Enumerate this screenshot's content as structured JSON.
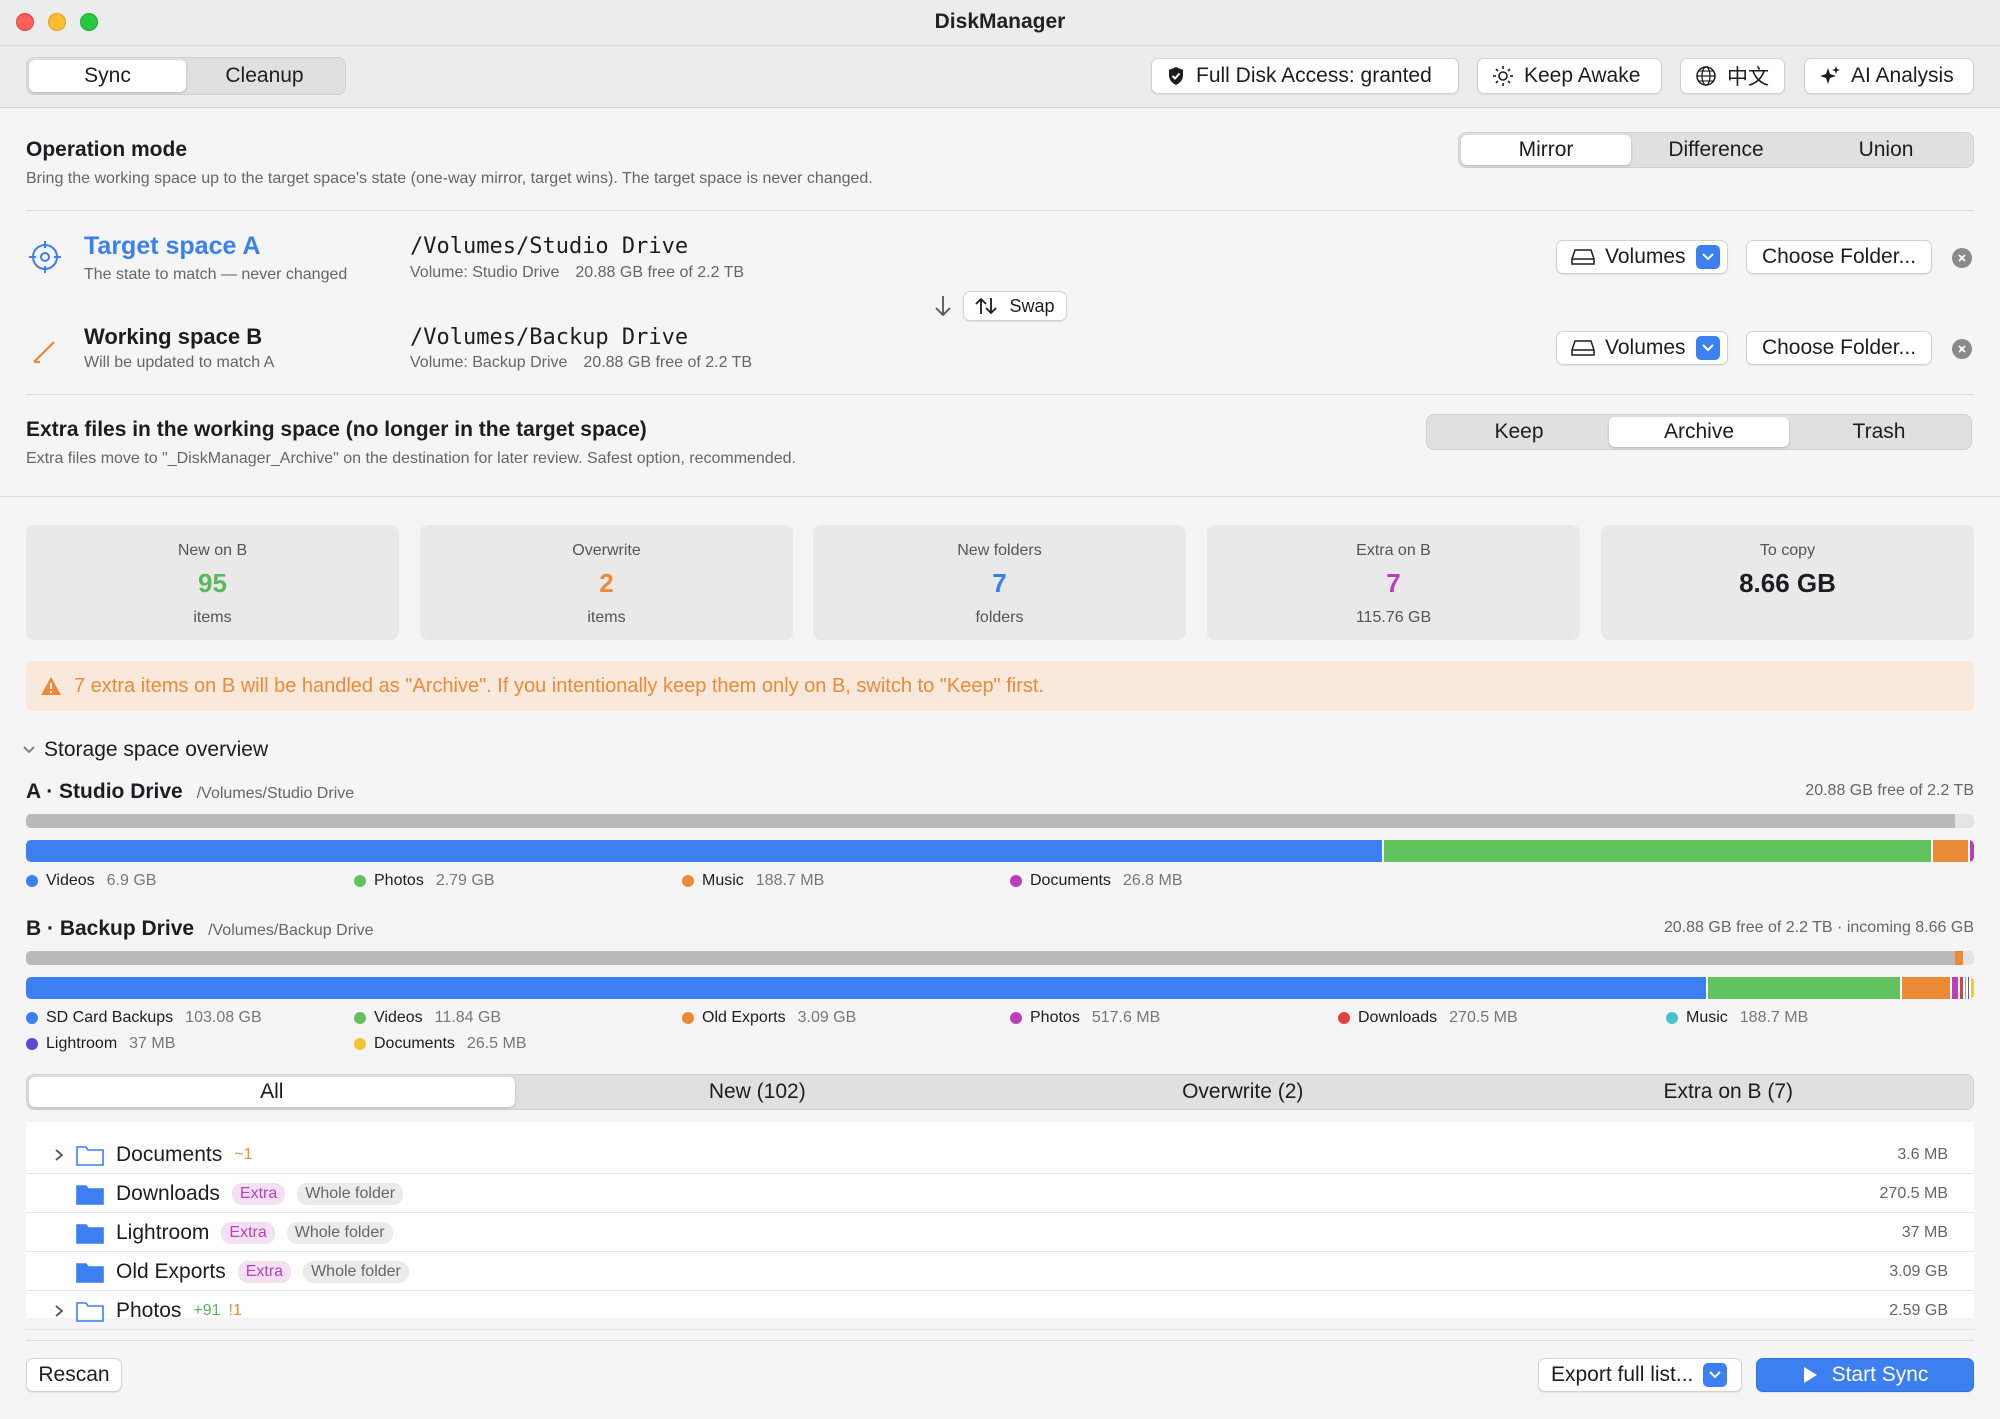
{
  "window": {
    "title": "DiskManager"
  },
  "toolbar": {
    "mode_tabs": [
      "Sync",
      "Cleanup"
    ],
    "full_disk_access": "Full Disk Access: granted",
    "keep_awake": "Keep Awake",
    "language": "中文",
    "ai_analysis": "AI Analysis"
  },
  "operation": {
    "title": "Operation mode",
    "description": "Bring the working space up to the target space's state (one-way mirror, target wins). The target space is never changed.",
    "modes": [
      "Mirror",
      "Difference",
      "Union"
    ],
    "selected": "Mirror"
  },
  "spaces": {
    "target": {
      "title": "Target space A",
      "subtitle": "The state to match — never changed",
      "path": "/Volumes/Studio Drive",
      "volume": "Volume: Studio Drive",
      "free": "20.88 GB free of 2.2 TB"
    },
    "working": {
      "title": "Working space B",
      "subtitle": "Will be updated to match A",
      "path": "/Volumes/Backup Drive",
      "volume": "Volume: Backup Drive",
      "free": "20.88 GB free of 2.2 TB"
    },
    "swap_label": "Swap",
    "volumes_label": "Volumes",
    "choose_folder_label": "Choose Folder..."
  },
  "extra": {
    "title": "Extra files in the working space (no longer in the target space)",
    "description": "Extra files move to \"_DiskManager_Archive\" on the destination for later review. Safest option, recommended.",
    "options": [
      "Keep",
      "Archive",
      "Trash"
    ],
    "selected": "Archive"
  },
  "stats": [
    {
      "label": "New on B",
      "value": "95",
      "unit": "items",
      "color": "#5cb85c"
    },
    {
      "label": "Overwrite",
      "value": "2",
      "unit": "items",
      "color": "#ec8a36"
    },
    {
      "label": "New folders",
      "value": "7",
      "unit": "folders",
      "color": "#3b7ff0"
    },
    {
      "label": "Extra on B",
      "value": "7",
      "unit": "115.76 GB",
      "color": "#b93fbd"
    },
    {
      "label": "To copy",
      "value": "8.66 GB",
      "unit": "",
      "color": "#1d1d1f"
    }
  ],
  "warning": "7 extra items on B will be handled as \"Archive\". If you intentionally keep them only on B, switch to \"Keep\" first.",
  "storage": {
    "title": "Storage space overview",
    "a": {
      "name": "A · Studio Drive",
      "path": "/Volumes/Studio Drive",
      "free": "20.88 GB free of 2.2 TB",
      "used_fraction": 0.9905,
      "segments": [
        {
          "name": "Videos",
          "size": "6.9 GB",
          "color": "#3b7ff0",
          "fraction": 0.697
        },
        {
          "name": "Photos",
          "size": "2.79 GB",
          "color": "#62c35e",
          "fraction": 0.282
        },
        {
          "name": "Music",
          "size": "188.7 MB",
          "color": "#ec8a36",
          "fraction": 0.019
        },
        {
          "name": "Documents",
          "size": "26.8 MB",
          "color": "#b93fbd",
          "fraction": 0.002
        }
      ]
    },
    "b": {
      "name": "B · Backup Drive",
      "path": "/Volumes/Backup Drive",
      "free": "20.88 GB free of 2.2 TB · incoming 8.66 GB",
      "used_fraction": 0.9905,
      "segments": [
        {
          "name": "SD Card Backups",
          "size": "103.08 GB",
          "color": "#3b7ff0",
          "fraction": 0.866
        },
        {
          "name": "Videos",
          "size": "11.84 GB",
          "color": "#62c35e",
          "fraction": 0.0995
        },
        {
          "name": "Old Exports",
          "size": "3.09 GB",
          "color": "#ec8a36",
          "fraction": 0.026
        },
        {
          "name": "Photos",
          "size": "517.6 MB",
          "color": "#b93fbd",
          "fraction": 0.0043
        },
        {
          "name": "Downloads",
          "size": "270.5 MB",
          "color": "#e0413b",
          "fraction": 0.0023
        },
        {
          "name": "Music",
          "size": "188.7 MB",
          "color": "#4cc2d0",
          "fraction": 0.0016
        },
        {
          "name": "Lightroom",
          "size": "37 MB",
          "color": "#5b4bd6",
          "fraction": 0.0003
        },
        {
          "name": "Documents",
          "size": "26.5 MB",
          "color": "#f2c633",
          "fraction": 0.0002
        }
      ]
    }
  },
  "filter_tabs": [
    "All",
    "New (102)",
    "Overwrite (2)",
    "Extra on B (7)"
  ],
  "files": [
    {
      "name": "Documents",
      "expandable": true,
      "change": "~1",
      "change2": "",
      "badges": [],
      "size": "3.6 MB",
      "filled": false
    },
    {
      "name": "Downloads",
      "expandable": false,
      "change": "",
      "change2": "",
      "badges": [
        "Extra",
        "Whole folder"
      ],
      "size": "270.5 MB",
      "filled": true
    },
    {
      "name": "Lightroom",
      "expandable": false,
      "change": "",
      "change2": "",
      "badges": [
        "Extra",
        "Whole folder"
      ],
      "size": "37 MB",
      "filled": true
    },
    {
      "name": "Old Exports",
      "expandable": false,
      "change": "",
      "change2": "",
      "badges": [
        "Extra",
        "Whole folder"
      ],
      "size": "3.09 GB",
      "filled": true
    },
    {
      "name": "Photos",
      "expandable": true,
      "change": "+91",
      "change2": "!1",
      "badges": [],
      "size": "2.59 GB",
      "filled": false
    }
  ],
  "footer": {
    "rescan": "Rescan",
    "export": "Export full list...",
    "start": "Start Sync"
  }
}
